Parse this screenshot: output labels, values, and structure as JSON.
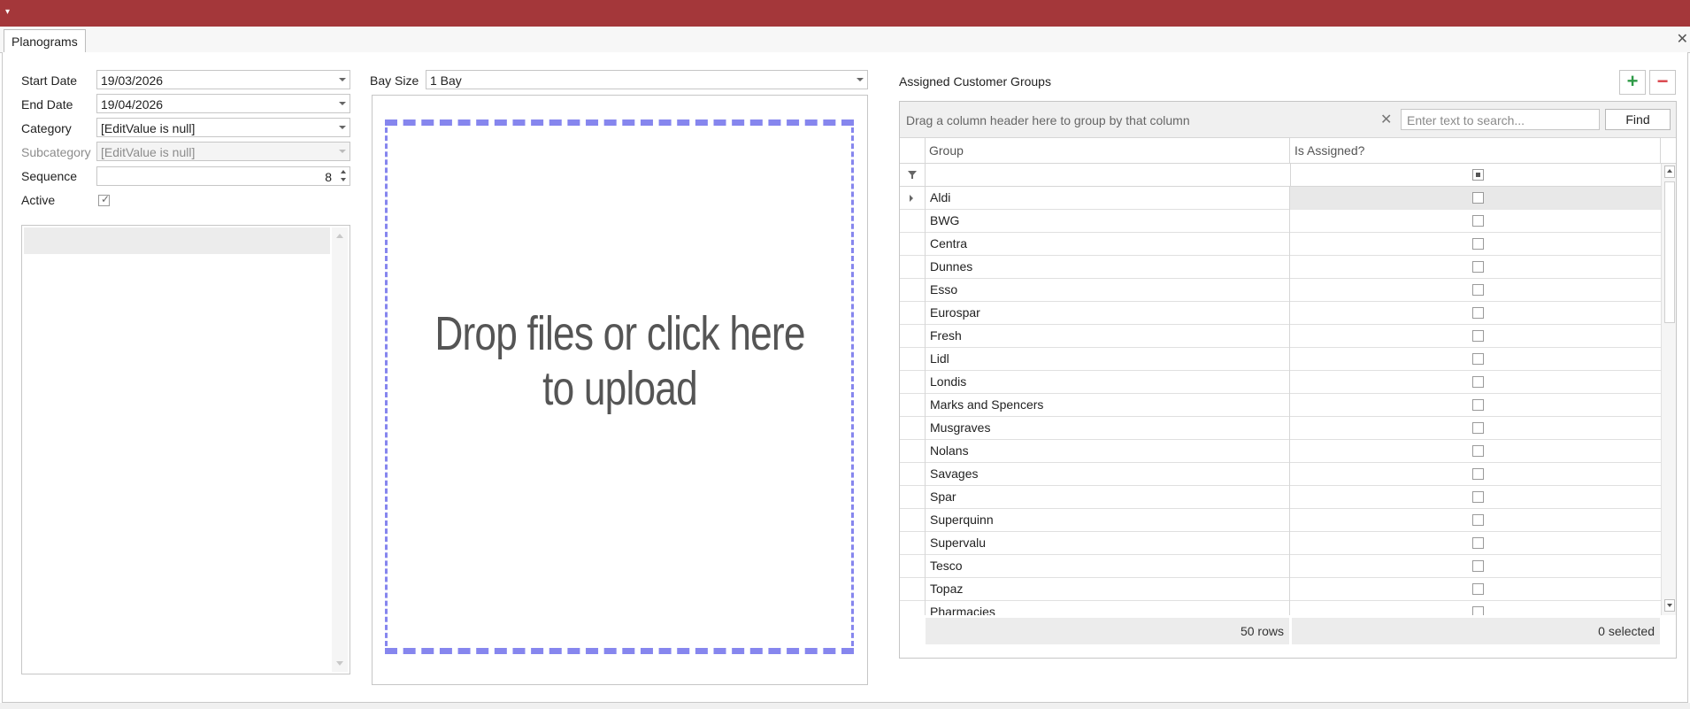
{
  "window": {
    "tab_label": "Planograms"
  },
  "form": {
    "start_date": {
      "label": "Start Date",
      "value": "19/03/2026"
    },
    "end_date": {
      "label": "End Date",
      "value": "19/04/2026"
    },
    "category": {
      "label": "Category",
      "value": "[EditValue is null]"
    },
    "subcategory": {
      "label": "Subcategory",
      "value": "[EditValue is null]"
    },
    "sequence": {
      "label": "Sequence",
      "value": "8"
    },
    "active": {
      "label": "Active",
      "checked": true
    },
    "bay_size": {
      "label": "Bay Size",
      "value": "1 Bay"
    }
  },
  "upload": {
    "text": "Drop files or click here to upload"
  },
  "groups": {
    "title": "Assigned Customer Groups",
    "add_icon": "plus-icon",
    "remove_icon": "minus-icon",
    "group_panel_hint": "Drag a column header here to group by that column",
    "search_placeholder": "Enter text to search...",
    "find_label": "Find",
    "columns": [
      "Group",
      "Is Assigned?"
    ],
    "rows": [
      {
        "group": "Aldi",
        "assigned": false
      },
      {
        "group": "BWG",
        "assigned": false
      },
      {
        "group": "Centra",
        "assigned": false
      },
      {
        "group": "Dunnes",
        "assigned": false
      },
      {
        "group": "Esso",
        "assigned": false
      },
      {
        "group": "Eurospar",
        "assigned": false
      },
      {
        "group": "Fresh",
        "assigned": false
      },
      {
        "group": "Lidl",
        "assigned": false
      },
      {
        "group": "Londis",
        "assigned": false
      },
      {
        "group": "Marks and Spencers",
        "assigned": false
      },
      {
        "group": "Musgraves",
        "assigned": false
      },
      {
        "group": "Nolans",
        "assigned": false
      },
      {
        "group": "Savages",
        "assigned": false
      },
      {
        "group": "Spar",
        "assigned": false
      },
      {
        "group": "Superquinn",
        "assigned": false
      },
      {
        "group": "Supervalu",
        "assigned": false
      },
      {
        "group": "Tesco",
        "assigned": false
      },
      {
        "group": "Topaz",
        "assigned": false
      },
      {
        "group": "Pharmacies",
        "assigned": false
      }
    ],
    "footer_rows": "50 rows",
    "footer_selected": "0 selected"
  },
  "colors": {
    "titlebar": "#a4373a",
    "upload_border": "#8686ee",
    "add_green": "#2e9a47",
    "remove_red": "#d9434a"
  }
}
